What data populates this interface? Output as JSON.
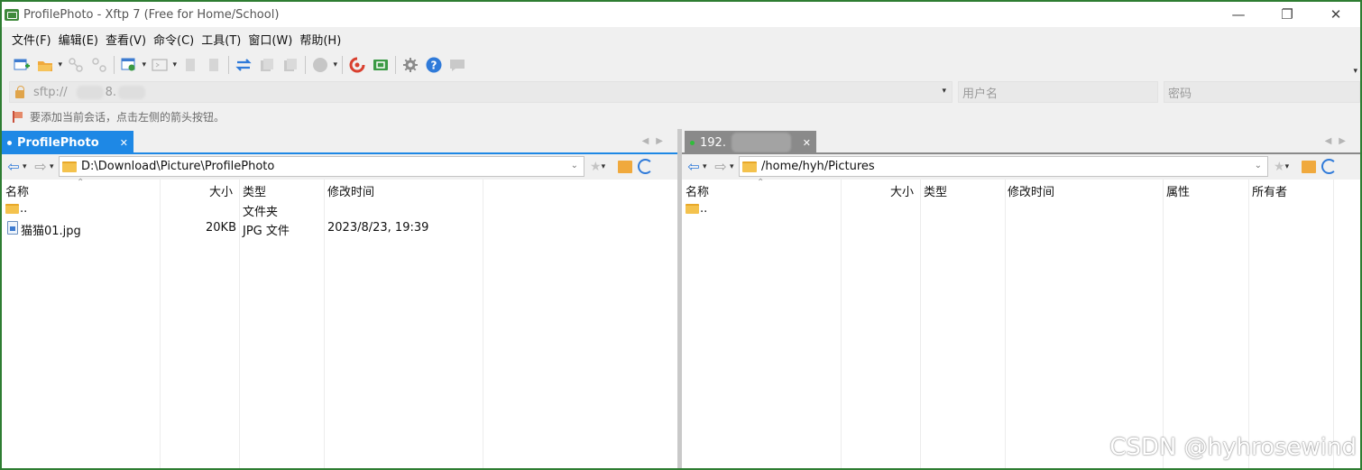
{
  "window": {
    "title": "ProfilePhoto - Xftp 7 (Free for Home/School)",
    "controls": [
      "—",
      "❐",
      "✕"
    ]
  },
  "menu": [
    "文件(F)",
    "编辑(E)",
    "查看(V)",
    "命令(C)",
    "工具(T)",
    "窗口(W)",
    "帮助(H)"
  ],
  "address": {
    "value": "sftp://",
    "value_tail": "8.",
    "username_placeholder": "用户名",
    "password_placeholder": "密码"
  },
  "hint": "要添加当前会话，点击左侧的箭头按钮。",
  "left_pane": {
    "tab_label": "ProfilePhoto",
    "path": "D:\\Download\\Picture\\ProfilePhoto",
    "columns": [
      "名称",
      "大小",
      "类型",
      "修改时间"
    ],
    "rows": [
      {
        "name": "..",
        "size": "",
        "type": "文件夹",
        "modified": ""
      },
      {
        "name": "猫猫01.jpg",
        "size": "20KB",
        "type": "JPG 文件",
        "modified": "2023/8/23, 19:39"
      }
    ]
  },
  "right_pane": {
    "tab_label": "192.",
    "path": "/home/hyh/Pictures",
    "columns": [
      "名称",
      "大小",
      "类型",
      "修改时间",
      "属性",
      "所有者"
    ],
    "rows": [
      {
        "name": ".."
      }
    ]
  },
  "watermark": "CSDN @hyhrosewind",
  "colors": {
    "frame_border": "#2e7d32",
    "active_tab": "#1e88e5",
    "inactive_tab": "#8a8a8a",
    "session_dot": "#2fbd3a"
  }
}
